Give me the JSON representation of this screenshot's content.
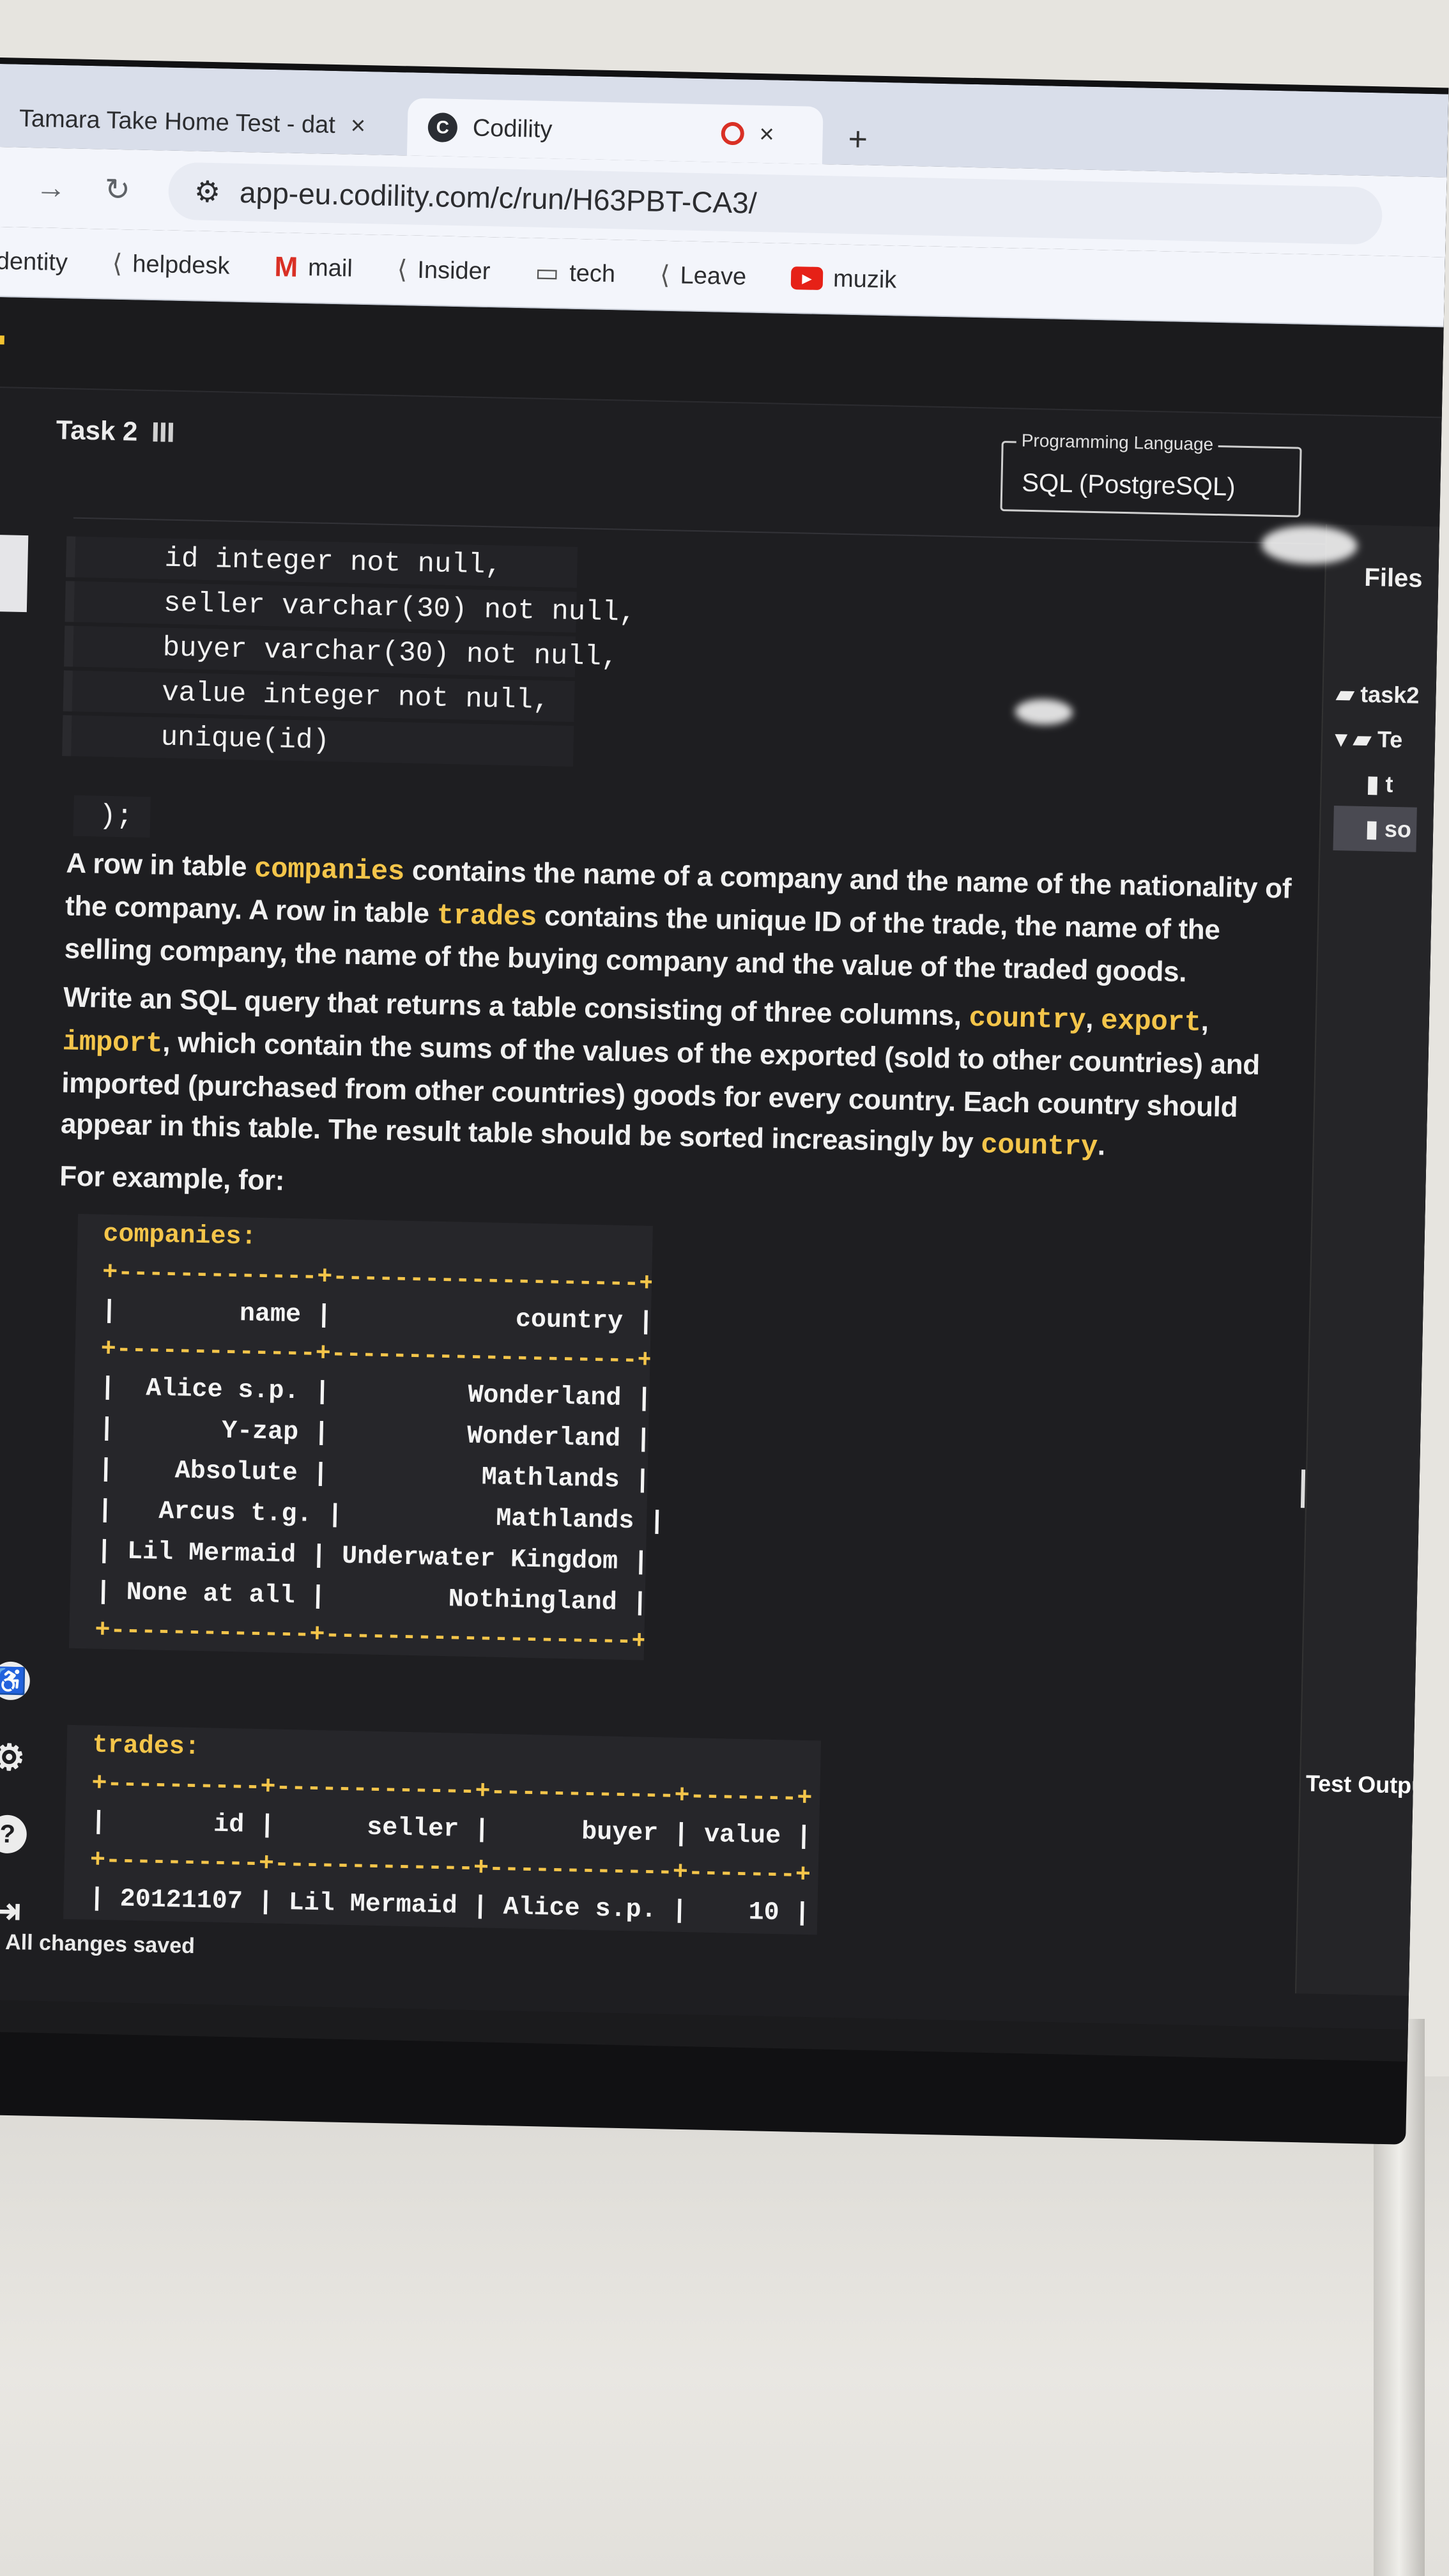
{
  "browser": {
    "tabs": [
      {
        "title": "Tamara Take Home Test - dat",
        "active": false
      },
      {
        "title": "Codility",
        "active": true
      }
    ],
    "tab_close": "×",
    "new_tab": "+",
    "url": "app-eu.codility.com/c/run/H63PBT-CA3/",
    "bookmarks": [
      {
        "label": "Identity",
        "icon": ""
      },
      {
        "label": "helpdesk",
        "icon": "link-icon"
      },
      {
        "label": "mail",
        "icon": "gmail-icon"
      },
      {
        "label": "Insider",
        "icon": "link-icon"
      },
      {
        "label": "tech",
        "icon": "folder-icon"
      },
      {
        "label": "Leave",
        "icon": "link-icon"
      },
      {
        "label": "muzik",
        "icon": "youtube-icon"
      }
    ]
  },
  "task": {
    "title": "Task 2",
    "language_label": "Programming Language",
    "language_value": "SQL (PostgreSQL)"
  },
  "schema_code": [
    "id integer not null,",
    "seller varchar(30) not null,",
    "buyer varchar(30) not null,",
    "value integer not null,",
    "unique(id)"
  ],
  "schema_close": ");",
  "description": {
    "p1": {
      "a": "A row in table ",
      "k1": "companies",
      "b": " contains the name of a company and the name of the nationality of the company. A row in table ",
      "k2": "trades",
      "c": " contains the unique ID of the trade, the name of the selling company, the name of the buying company and the value of the traded goods."
    },
    "p2": {
      "a": "Write an SQL query that returns a table consisting of three columns, ",
      "k1": "country",
      "s1": ", ",
      "k2": "export",
      "s2": ", ",
      "k3": "import",
      "b": ", which contain the sums of the values of the exported (sold to other countries) and imported (purchased from other countries) goods for every country. Each country should appear in this table. The result table should be sorted increasingly by ",
      "k4": "country",
      "c": "."
    },
    "example_intro": "For example, for:"
  },
  "companies_table": {
    "title": "companies:",
    "border": "+-------------+--------------------+",
    "header": "|        name |            country |",
    "rows": [
      "|  Alice s.p. |         Wonderland |",
      "|       Y-zap |         Wonderland |",
      "|    Absolute |          Mathlands |",
      "|   Arcus t.g. |          Mathlands |",
      "| Lil Mermaid | Underwater Kingdom |",
      "| None at all |        Nothingland |"
    ]
  },
  "trades_table": {
    "title": "trades:",
    "border": "+----------+-------------+------------+-------+",
    "header": "|       id |      seller |      buyer | value |",
    "rows": [
      "| 20121107 | Lil Mermaid | Alice s.p. |    10 |"
    ]
  },
  "files_panel": {
    "title": "Files",
    "items": [
      "task2",
      "Te",
      "t",
      "so"
    ]
  },
  "test_output_label": "Test Outpu",
  "status": "All changes saved",
  "side_icons": [
    "accessibility-icon",
    "settings-icon",
    "help-icon",
    "exit-icon"
  ]
}
